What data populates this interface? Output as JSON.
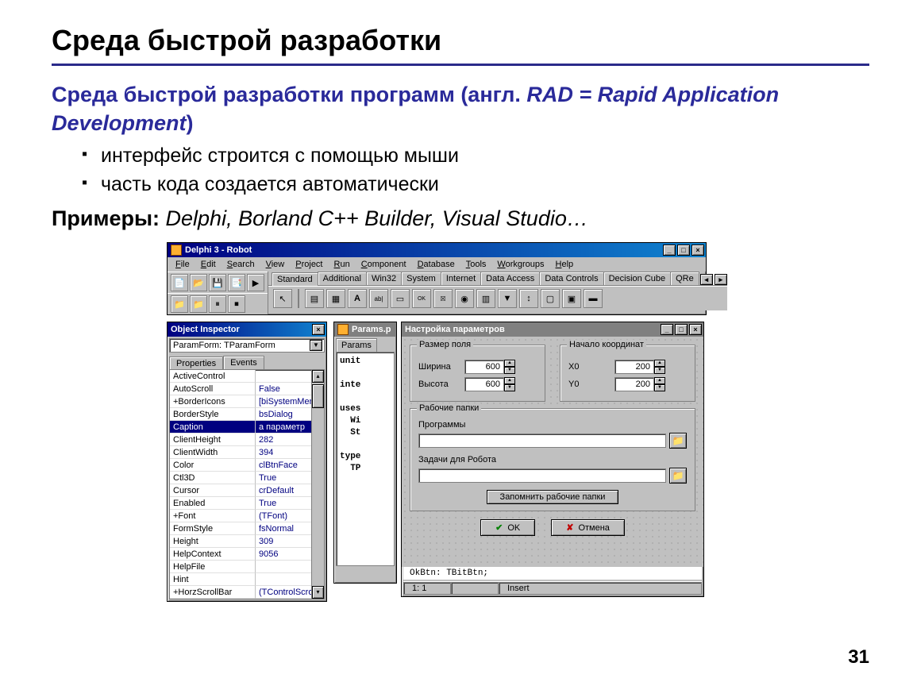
{
  "slide": {
    "title": "Среда быстрой разработки",
    "subtitle_pre": "Среда быстрой разработки программ (англ. ",
    "subtitle_rad": "RAD = Rapid Application Development",
    "subtitle_post": ")",
    "bullets": [
      "интерфейс строится с помощью мыши",
      "часть кода создается автоматически"
    ],
    "examples_label": "Примеры:",
    "examples_list": " Delphi, Borland C++ Builder, Visual Studio…",
    "page_number": "31"
  },
  "delphi": {
    "main_title": "Delphi 3 - Robot",
    "menus": [
      "File",
      "Edit",
      "Search",
      "View",
      "Project",
      "Run",
      "Component",
      "Database",
      "Tools",
      "Workgroups",
      "Help"
    ],
    "component_tabs": [
      "Standard",
      "Additional",
      "Win32",
      "System",
      "Internet",
      "Data Access",
      "Data Controls",
      "Decision Cube",
      "QRe"
    ],
    "inspector": {
      "title": "Object Inspector",
      "combo": "ParamForm: TParamForm",
      "tabs": [
        "Properties",
        "Events"
      ],
      "rows": [
        {
          "k": "ActiveControl",
          "v": ""
        },
        {
          "k": "AutoScroll",
          "v": "False"
        },
        {
          "k": "+BorderIcons",
          "v": "[biSystemMen"
        },
        {
          "k": "BorderStyle",
          "v": "bsDialog"
        },
        {
          "k": "Caption",
          "v": "а параметр",
          "sel": true
        },
        {
          "k": "ClientHeight",
          "v": "282"
        },
        {
          "k": "ClientWidth",
          "v": "394"
        },
        {
          "k": "Color",
          "v": "clBtnFace"
        },
        {
          "k": "Ctl3D",
          "v": "True"
        },
        {
          "k": "Cursor",
          "v": "crDefault"
        },
        {
          "k": "Enabled",
          "v": "True"
        },
        {
          "k": "+Font",
          "v": "(TFont)"
        },
        {
          "k": "FormStyle",
          "v": "fsNormal"
        },
        {
          "k": "Height",
          "v": "309"
        },
        {
          "k": "HelpContext",
          "v": "9056"
        },
        {
          "k": "HelpFile",
          "v": ""
        },
        {
          "k": "Hint",
          "v": ""
        },
        {
          "k": "+HorzScrollBar",
          "v": "(TControlScro"
        }
      ]
    },
    "code_win": {
      "title": "Params.p",
      "tab": "Params",
      "lines": "unit\n\ninte\n\nuses\n  Wi\n  St\n\ntype\n  TP",
      "status_line": "OkBtn: TBitBtn;",
      "status": {
        "pos": "1:  1",
        "mode": "Insert"
      }
    },
    "params_dialog": {
      "title": "Настройка параметров",
      "group_size": "Размер поля",
      "width_label": "Ширина",
      "width_value": "600",
      "height_label": "Высота",
      "height_value": "600",
      "group_origin": "Начало координат",
      "x0_label": "X0",
      "x0_value": "200",
      "y0_label": "Y0",
      "y0_value": "200",
      "group_folders": "Рабочие папки",
      "programs_label": "Программы",
      "tasks_label": "Задачи для Робота",
      "remember_btn": "Запомнить рабочие папки",
      "ok_btn": "OK",
      "cancel_btn": "Отмена"
    }
  }
}
